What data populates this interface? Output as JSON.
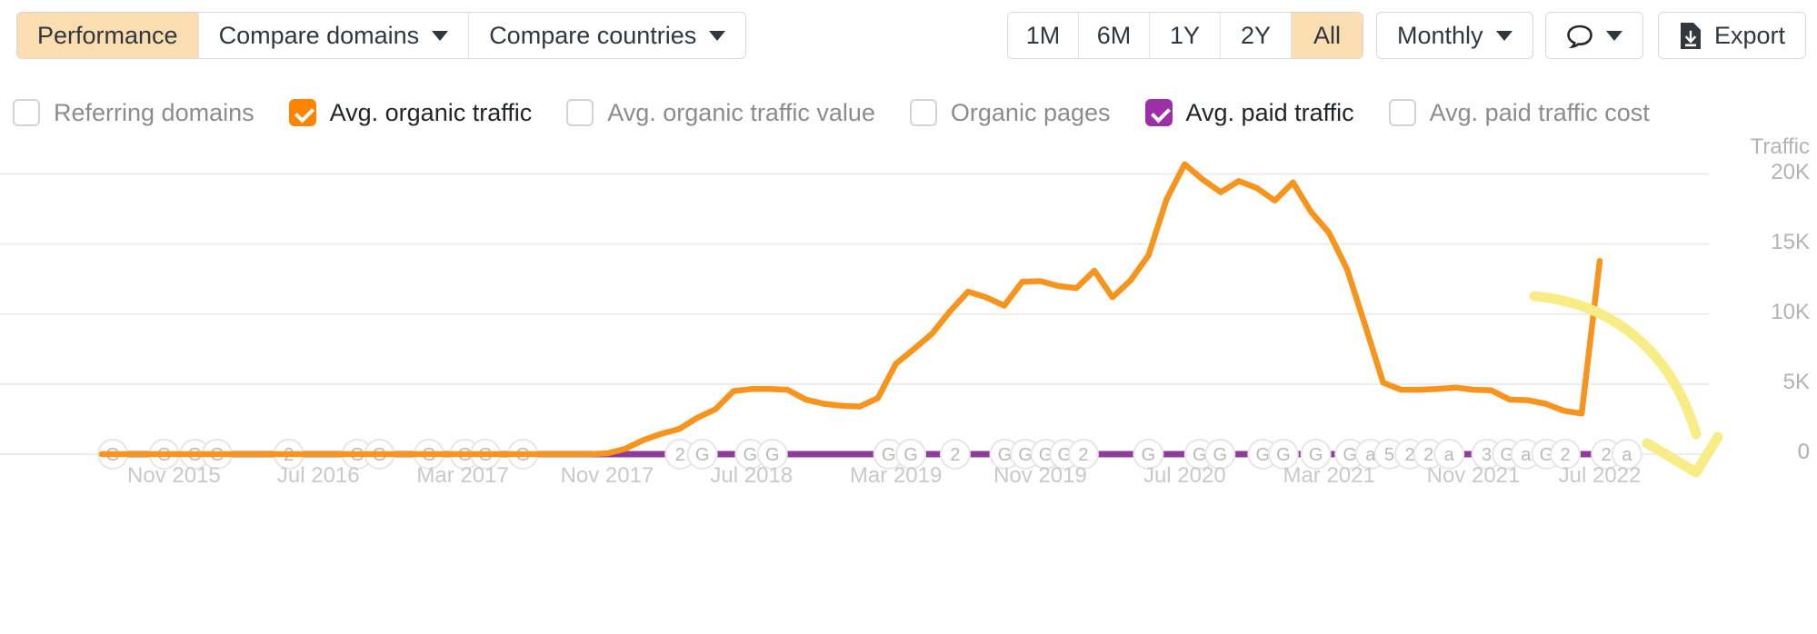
{
  "toolbar": {
    "tabs": [
      {
        "label": "Performance",
        "active": true,
        "caret": false
      },
      {
        "label": "Compare domains",
        "active": false,
        "caret": true
      },
      {
        "label": "Compare countries",
        "active": false,
        "caret": true
      }
    ],
    "ranges": [
      {
        "label": "1M",
        "active": false
      },
      {
        "label": "6M",
        "active": false
      },
      {
        "label": "1Y",
        "active": false
      },
      {
        "label": "2Y",
        "active": false
      },
      {
        "label": "All",
        "active": true
      }
    ],
    "period": {
      "label": "Monthly"
    },
    "notes": {
      "icon": "speech-bubble-icon"
    },
    "export": {
      "label": "Export",
      "icon": "download-file-icon"
    }
  },
  "legend": {
    "items": [
      {
        "label": "Referring domains",
        "checked": false,
        "color": "#9bb0c1"
      },
      {
        "label": "Avg. organic traffic",
        "checked": true,
        "color": "#ff8400"
      },
      {
        "label": "Avg. organic traffic value",
        "checked": false,
        "color": "#7fb800"
      },
      {
        "label": "Organic pages",
        "checked": false,
        "color": "#00a0c6"
      },
      {
        "label": "Avg. paid traffic",
        "checked": true,
        "color": "#9b30a8"
      },
      {
        "label": "Avg. paid traffic cost",
        "checked": false,
        "color": "#d94f4f"
      }
    ]
  },
  "colors": {
    "organic_traffic": "#f7941d",
    "paid_traffic": "#8e3b99",
    "annotation_arrow": "#f7ec86",
    "active_tab": "#fbddb2",
    "gridline": "#ededed",
    "axis_text": "#b3b3b3"
  },
  "chart_data": {
    "type": "line",
    "title": "",
    "ylabel": "Traffic",
    "xlabel": "",
    "ylim": [
      0,
      22500
    ],
    "yticks": [
      0,
      5000,
      10000,
      15000,
      20000
    ],
    "ytick_labels": [
      "0",
      "5K",
      "10K",
      "15K",
      "20K"
    ],
    "grid": true,
    "legend_position": "top",
    "xtick_labels": [
      "Nov 2015",
      "Jul 2016",
      "Mar 2017",
      "Nov 2017",
      "Jul 2018",
      "Mar 2019",
      "Nov 2019",
      "Jul 2020",
      "Mar 2021",
      "Nov 2021",
      "Jul 2022"
    ],
    "series": [
      {
        "name": "Avg. organic traffic",
        "color": "#f7941d",
        "x": [
          "Jul 2015",
          "Aug 2015",
          "Sep 2015",
          "Oct 2015",
          "Nov 2015",
          "Dec 2015",
          "Jan 2016",
          "Feb 2016",
          "Mar 2016",
          "Apr 2016",
          "May 2016",
          "Jun 2016",
          "Jul 2016",
          "Aug 2016",
          "Sep 2016",
          "Oct 2016",
          "Nov 2016",
          "Dec 2016",
          "Jan 2017",
          "Feb 2017",
          "Mar 2017",
          "Apr 2017",
          "May 2017",
          "Jun 2017",
          "Jul 2017",
          "Aug 2017",
          "Sep 2017",
          "Oct 2017",
          "Nov 2017",
          "Dec 2017",
          "Jan 2018",
          "Feb 2018",
          "Mar 2018",
          "Apr 2018",
          "May 2018",
          "Jun 2018",
          "Jul 2018",
          "Aug 2018",
          "Sep 2018",
          "Oct 2018",
          "Nov 2018",
          "Dec 2018",
          "Jan 2019",
          "Feb 2019",
          "Mar 2019",
          "Apr 2019",
          "May 2019",
          "Jun 2019",
          "Jul 2019",
          "Aug 2019",
          "Sep 2019",
          "Oct 2019",
          "Nov 2019",
          "Dec 2019",
          "Jan 2020",
          "Feb 2020",
          "Mar 2020",
          "Apr 2020",
          "May 2020",
          "Jun 2020",
          "Jul 2020",
          "Aug 2020",
          "Sep 2020",
          "Oct 2020",
          "Nov 2020",
          "Dec 2020",
          "Jan 2021",
          "Feb 2021",
          "Mar 2021",
          "Apr 2021",
          "May 2021",
          "Jun 2021",
          "Jul 2021",
          "Aug 2021",
          "Sep 2021",
          "Oct 2021",
          "Nov 2021",
          "Dec 2021",
          "Jan 2022",
          "Feb 2022",
          "Mar 2022",
          "Apr 2022",
          "May 2022",
          "Jun 2022",
          "Jul 2022"
        ],
        "values": [
          0,
          0,
          0,
          0,
          0,
          0,
          0,
          0,
          0,
          0,
          0,
          0,
          0,
          0,
          0,
          0,
          0,
          0,
          0,
          0,
          0,
          0,
          0,
          0,
          0,
          0,
          0,
          0,
          60,
          380,
          1000,
          1450,
          1800,
          2600,
          3200,
          4500,
          4650,
          4650,
          4600,
          3900,
          3600,
          3450,
          3400,
          4000,
          6450,
          7500,
          8600,
          10200,
          11600,
          11200,
          10600,
          12300,
          12350,
          12000,
          11850,
          13100,
          11200,
          12400,
          14200,
          18200,
          20700,
          19600,
          18700,
          19500,
          19000,
          18100,
          19400,
          17300,
          15800,
          13200,
          9200,
          5100,
          4600,
          4600,
          4650,
          4750,
          4600,
          4550,
          3900,
          3850,
          3600,
          3100,
          2900,
          13800
        ]
      },
      {
        "name": "Avg. paid traffic",
        "color": "#8e3b99",
        "x": [
          "Jul 2015",
          "Jul 2022"
        ],
        "values": [
          0,
          0
        ]
      }
    ],
    "timeline_markers": [
      {
        "label": "G",
        "x_pct": 6.6
      },
      {
        "label": "G",
        "x_pct": 9.6
      },
      {
        "label": "G",
        "x_pct": 11.4
      },
      {
        "label": "G",
        "x_pct": 12.7
      },
      {
        "label": "2",
        "x_pct": 16.9
      },
      {
        "label": "G",
        "x_pct": 20.9
      },
      {
        "label": "G",
        "x_pct": 22.2
      },
      {
        "label": "G",
        "x_pct": 25.1
      },
      {
        "label": "G",
        "x_pct": 27.2
      },
      {
        "label": "G",
        "x_pct": 28.4
      },
      {
        "label": "G",
        "x_pct": 30.6
      },
      {
        "label": "2",
        "x_pct": 39.8
      },
      {
        "label": "G",
        "x_pct": 41.1
      },
      {
        "label": "G",
        "x_pct": 43.9
      },
      {
        "label": "G",
        "x_pct": 45.2
      },
      {
        "label": "G",
        "x_pct": 52.0
      },
      {
        "label": "G",
        "x_pct": 53.3
      },
      {
        "label": "2",
        "x_pct": 55.9
      },
      {
        "label": "G",
        "x_pct": 58.8
      },
      {
        "label": "G",
        "x_pct": 60.0
      },
      {
        "label": "G",
        "x_pct": 61.2
      },
      {
        "label": "G",
        "x_pct": 62.3
      },
      {
        "label": "2",
        "x_pct": 63.4
      },
      {
        "label": "G",
        "x_pct": 67.2
      },
      {
        "label": "G",
        "x_pct": 70.2
      },
      {
        "label": "G",
        "x_pct": 71.4
      },
      {
        "label": "G",
        "x_pct": 73.9
      },
      {
        "label": "G",
        "x_pct": 75.1
      },
      {
        "label": "G",
        "x_pct": 77.0
      },
      {
        "label": "G",
        "x_pct": 79.0
      },
      {
        "label": "a",
        "x_pct": 80.2
      },
      {
        "label": "5",
        "x_pct": 81.3
      },
      {
        "label": "2",
        "x_pct": 82.5
      },
      {
        "label": "2",
        "x_pct": 83.6
      },
      {
        "label": "a",
        "x_pct": 84.8
      },
      {
        "label": "3",
        "x_pct": 87.0
      },
      {
        "label": "G",
        "x_pct": 88.2
      },
      {
        "label": "a",
        "x_pct": 89.3
      },
      {
        "label": "G",
        "x_pct": 90.5
      },
      {
        "label": "2",
        "x_pct": 91.6
      },
      {
        "label": "2",
        "x_pct": 94.0
      },
      {
        "label": "a",
        "x_pct": 95.2
      }
    ],
    "annotation": {
      "type": "curved-arrow",
      "color": "#f7ec86",
      "description": "Curved yellow arrow pointing down to the final spike"
    }
  }
}
